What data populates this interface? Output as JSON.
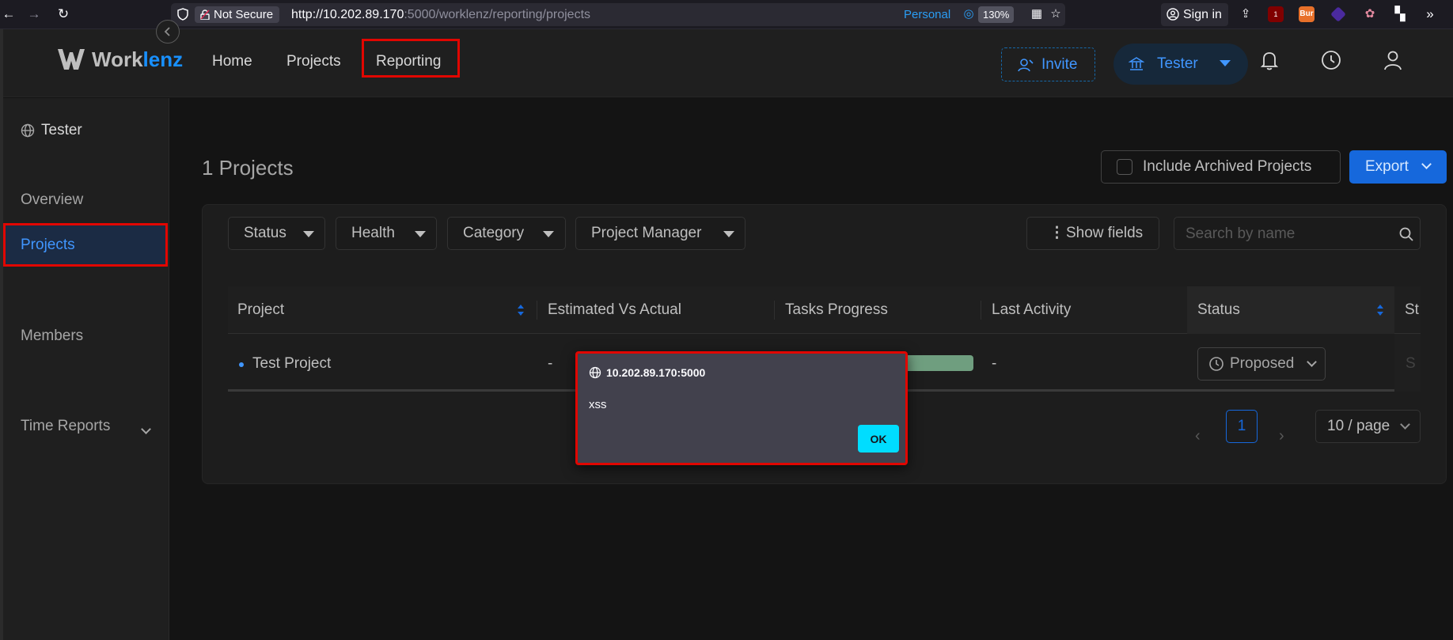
{
  "browser": {
    "security_label": "Not Secure",
    "url_host": "http://10.202.89.170",
    "url_path": ":5000/worklenz/reporting/projects",
    "container_label": "Personal",
    "zoom": "130%",
    "sign_in_label": "Sign in",
    "ext_badge": "1",
    "ext_burp_label": "Bur"
  },
  "header": {
    "logo_prefix": "Work",
    "logo_suffix": "lenz",
    "nav": [
      "Home",
      "Projects",
      "Reporting"
    ],
    "invite_label": "Invite",
    "org_label": "Tester"
  },
  "sidebar": {
    "title": "Tester",
    "items": [
      "Overview",
      "Projects",
      "Members",
      "Time Reports"
    ],
    "active_index": 1
  },
  "main": {
    "title": "1 Projects",
    "include_archived_label": "Include Archived Projects",
    "export_label": "Export",
    "filters": [
      "Status",
      "Health",
      "Category",
      "Project Manager"
    ],
    "show_fields_label": "Show fields",
    "search_placeholder": "Search by name",
    "columns": [
      "Project",
      "Estimated Vs Actual",
      "Tasks Progress",
      "Last Activity",
      "Status",
      "St"
    ],
    "rows": [
      {
        "project": "Test Project",
        "estimated_vs_actual": "-",
        "tasks_progress": 1.0,
        "last_activity": "-",
        "status": "Proposed",
        "clipped": "S"
      }
    ],
    "pagination": {
      "current_page": "1",
      "per_page": "10 / page"
    }
  },
  "alert": {
    "origin": "10.202.89.170:5000",
    "message": "xss",
    "ok_label": "OK"
  },
  "colors": {
    "accent": "#1668dc",
    "highlight_border": "#e10600",
    "progress": "#6f9e7f",
    "alert_button": "#00ddff"
  }
}
